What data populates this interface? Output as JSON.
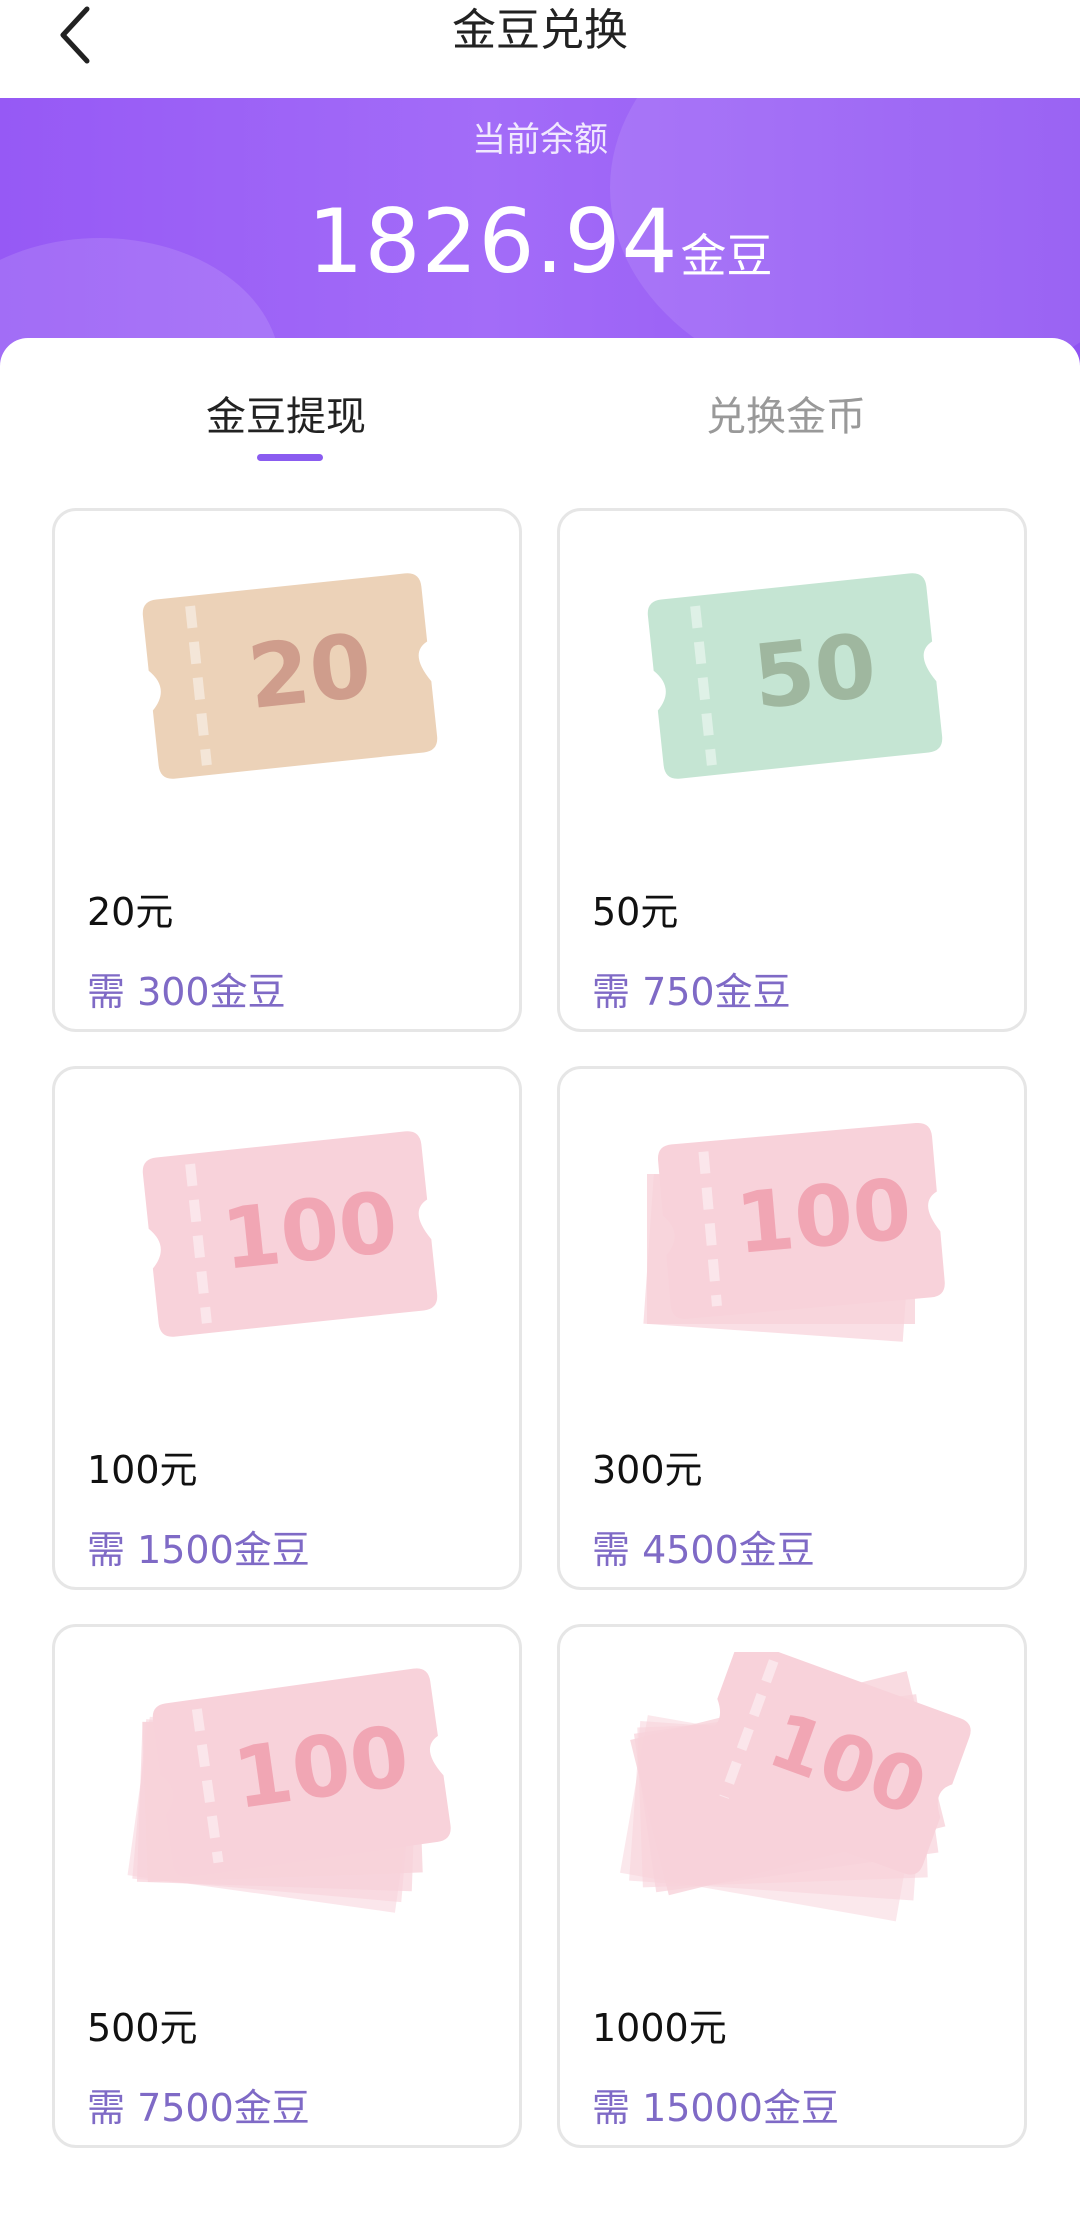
{
  "header": {
    "title": "金豆兑换"
  },
  "balance": {
    "label": "当前余额",
    "amount": "1826.94",
    "unit": "金豆"
  },
  "tabs": [
    {
      "label": "金豆提现",
      "active": true
    },
    {
      "label": "兑换金币",
      "active": false
    }
  ],
  "items": [
    {
      "ticket_number": "20",
      "name": "20元",
      "cost": "需 300金豆",
      "ticket_color": "#ecd2b8",
      "number_color": "#cf9d8c"
    },
    {
      "ticket_number": "50",
      "name": "50元",
      "cost": "需 750金豆",
      "ticket_color": "#c5e5d3",
      "number_color": "#9fb79f"
    },
    {
      "ticket_number": "100",
      "name": "100元",
      "cost": "需 1500金豆",
      "ticket_color": "#f8d2da",
      "number_color": "#f1a6b4"
    },
    {
      "ticket_number": "100",
      "name": "300元",
      "cost": "需 4500金豆",
      "ticket_color": "#f8d2da",
      "number_color": "#f1a6b4"
    },
    {
      "ticket_number": "100",
      "name": "500元",
      "cost": "需 7500金豆",
      "ticket_color": "#f8d2da",
      "number_color": "#f1a6b4"
    },
    {
      "ticket_number": "100",
      "name": "1000元",
      "cost": "需 15000金豆",
      "ticket_color": "#f8d2da",
      "number_color": "#f1a6b4"
    }
  ],
  "colors": {
    "accent": "#8a5cf0",
    "cost_text": "#7f6ac6",
    "banner_start": "#9659f5",
    "banner_end": "#8f52f2"
  }
}
